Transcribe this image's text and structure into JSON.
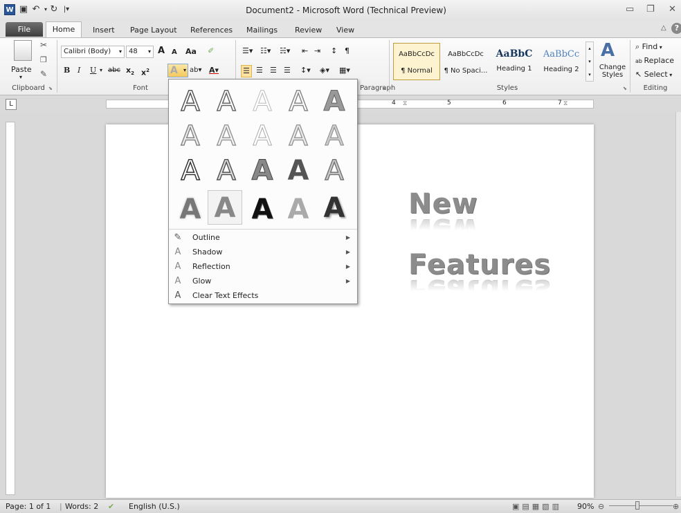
{
  "window": {
    "title": "Document2 - Microsoft Word (Technical Preview)"
  },
  "quick_access": {
    "word_icon": "W"
  },
  "tabs": [
    "File",
    "Home",
    "Insert",
    "Page Layout",
    "References",
    "Mailings",
    "Review",
    "View"
  ],
  "clipboard": {
    "paste_label": "Paste",
    "group_label": "Clipboard"
  },
  "font": {
    "name": "Calibri (Body)",
    "size": "48",
    "grow": "A",
    "shrink": "A",
    "change_case": "Aa",
    "bold": "B",
    "italic": "I",
    "underline": "U",
    "strike": "abc",
    "subscript": "x",
    "superscript": "x",
    "group_label": "Font"
  },
  "paragraph": {
    "group_label": "Paragraph"
  },
  "styles": {
    "items": [
      {
        "preview": "AaBbCcDc",
        "name": "¶ Normal"
      },
      {
        "preview": "AaBbCcDc",
        "name": "¶ No Spaci..."
      },
      {
        "preview": "AaBbC",
        "name": "Heading 1"
      },
      {
        "preview": "AaBbCc",
        "name": "Heading 2"
      }
    ],
    "change_styles": "Change Styles",
    "group_label": "Styles"
  },
  "editing": {
    "find": "Find",
    "replace": "Replace",
    "select": "Select",
    "group_label": "Editing"
  },
  "gallery": {
    "glyph": "A",
    "menu": [
      {
        "icon": "outline-icon",
        "label": "Outline",
        "submenu": true
      },
      {
        "icon": "shadow-icon",
        "label": "Shadow",
        "submenu": true
      },
      {
        "icon": "reflection-icon",
        "label": "Reflection",
        "submenu": true
      },
      {
        "icon": "glow-icon",
        "label": "Glow",
        "submenu": true
      },
      {
        "icon": "clear-effects-icon",
        "label": "Clear Text Effects",
        "submenu": false
      }
    ]
  },
  "document": {
    "line1": "New",
    "line2": "Features"
  },
  "ruler": {
    "marks": [
      "4",
      "5",
      "6",
      "7"
    ]
  },
  "status": {
    "page": "Page: 1 of 1",
    "words": "Words: 2",
    "language": "English (U.S.)",
    "zoom": "90%"
  }
}
